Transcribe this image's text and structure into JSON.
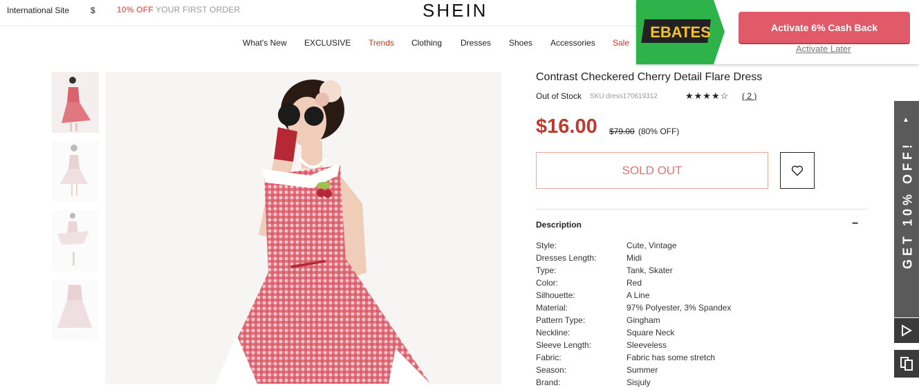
{
  "topbar": {
    "site": "International Site",
    "currency": "$",
    "promo_bold": "10% OFF",
    "promo_rest": " YOUR FIRST ORDER"
  },
  "logo": "SHEIN",
  "nav": [
    "What's New",
    "EXCLUSIVE",
    "Trends",
    "Clothing",
    "Dresses",
    "Shoes",
    "Accessories",
    "Sale"
  ],
  "product": {
    "title": "Contrast Checkered Cherry Detail Flare Dress",
    "stock": "Out of Stock",
    "sku": "SKU:dress170619312",
    "rating_stars": "★★★★☆",
    "rating_value": 4.5,
    "reviews": "( 2 )",
    "price": "$16.00",
    "old_price": "$79.00",
    "discount": "(80% OFF)",
    "sold_out": "SOLD OUT"
  },
  "description": {
    "heading": "Description",
    "toggle": "−",
    "attributes": [
      {
        "k": "Style:",
        "v": "Cute, Vintage"
      },
      {
        "k": "Dresses Length:",
        "v": "Midi"
      },
      {
        "k": "Type:",
        "v": "Tank, Skater"
      },
      {
        "k": "Color:",
        "v": "Red"
      },
      {
        "k": "Silhouette:",
        "v": "A Line"
      },
      {
        "k": "Material:",
        "v": "97% Polyester, 3% Spandex"
      },
      {
        "k": "Pattern Type:",
        "v": "Gingham"
      },
      {
        "k": "Neckline:",
        "v": "Square Neck"
      },
      {
        "k": "Sleeve Length:",
        "v": "Sleeveless"
      },
      {
        "k": "Fabric:",
        "v": "Fabric has some stretch"
      },
      {
        "k": "Season:",
        "v": "Summer"
      },
      {
        "k": "Brand:",
        "v": "Sisjuly"
      }
    ]
  },
  "ebates": {
    "logo_text": "EBATES",
    "activate": "Activate 6% Cash Back",
    "later": "Activate Later"
  },
  "side_tab": {
    "text": "GET 10% OFF!"
  },
  "colors": {
    "accent_red": "#c0392b",
    "ebates_green": "#2db34a",
    "ebates_button": "#e05a6a"
  }
}
